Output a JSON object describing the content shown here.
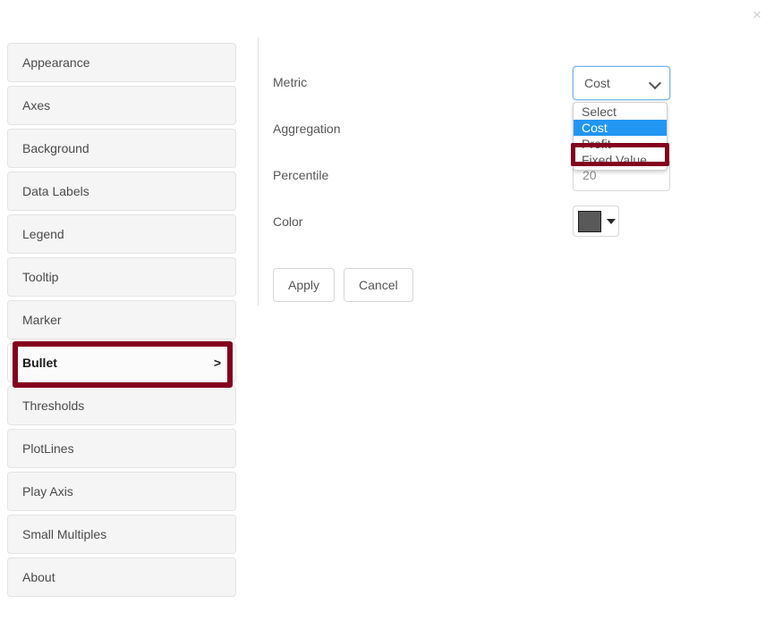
{
  "window": {
    "close_icon": "close-icon",
    "close_label": "×"
  },
  "sidebar": {
    "items": [
      {
        "label": "Appearance",
        "selected": false,
        "chevron": ""
      },
      {
        "label": "Axes",
        "selected": false,
        "chevron": ""
      },
      {
        "label": "Background",
        "selected": false,
        "chevron": ""
      },
      {
        "label": "Data Labels",
        "selected": false,
        "chevron": ""
      },
      {
        "label": "Legend",
        "selected": false,
        "chevron": ""
      },
      {
        "label": "Tooltip",
        "selected": false,
        "chevron": ""
      },
      {
        "label": "Marker",
        "selected": false,
        "chevron": ""
      },
      {
        "label": "Bullet",
        "selected": true,
        "chevron": ">"
      },
      {
        "label": "Thresholds",
        "selected": false,
        "chevron": ""
      },
      {
        "label": "PlotLines",
        "selected": false,
        "chevron": ""
      },
      {
        "label": "Play Axis",
        "selected": false,
        "chevron": ""
      },
      {
        "label": "Small Multiples",
        "selected": false,
        "chevron": ""
      },
      {
        "label": "About",
        "selected": false,
        "chevron": ""
      }
    ]
  },
  "form": {
    "metric": {
      "label": "Metric",
      "value": "Cost",
      "expanded": true,
      "options": [
        {
          "label": "Select",
          "selected": false
        },
        {
          "label": "Cost",
          "selected": true
        },
        {
          "label": "Profit",
          "selected": false
        },
        {
          "label": "Fixed Value",
          "selected": false
        }
      ]
    },
    "aggregation": {
      "label": "Aggregation"
    },
    "percentile": {
      "label": "Percentile",
      "value": "20"
    },
    "color": {
      "label": "Color",
      "value": "#595959"
    }
  },
  "buttons": {
    "apply": "Apply",
    "cancel": "Cancel"
  },
  "highlights": {
    "annotation_color": "#84001e",
    "bullet_target": "Bullet",
    "fixed_value_target": "Fixed Value"
  }
}
